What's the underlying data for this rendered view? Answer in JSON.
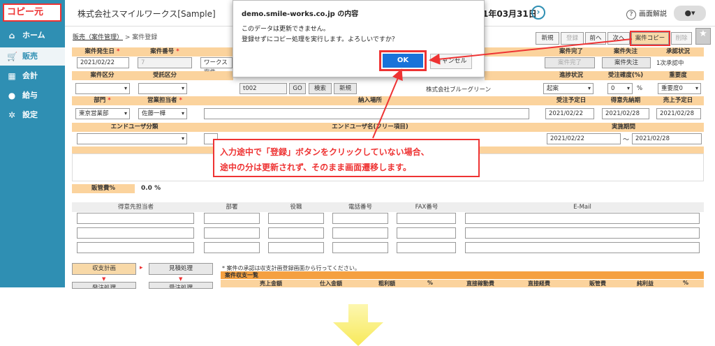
{
  "sidebar": {
    "copy_label": "コピー元",
    "items": [
      {
        "label": "ホーム",
        "icon": "home-icon"
      },
      {
        "label": "販売",
        "icon": "cart-icon"
      },
      {
        "label": "会計",
        "icon": "calculator-icon"
      },
      {
        "label": "給与",
        "icon": "moneybag-icon"
      },
      {
        "label": "設定",
        "icon": "gear-icon"
      }
    ]
  },
  "header": {
    "company": "株式会社スマイルワークス[Sample]",
    "date": "1年03月31日",
    "help_label": "画面解説"
  },
  "breadcrumb": {
    "parent": "販売（案件管理）",
    "current": "> 案件登録"
  },
  "toolbar": {
    "new": "新規",
    "register": "登録",
    "prev": "前へ",
    "next": "次へ",
    "copy": "案件コピー",
    "delete": "削除"
  },
  "form": {
    "hdr_date": "案件発生日",
    "hdr_no": "案件番号",
    "date_value": "2021/02/22",
    "no_value": "7",
    "name_value": "ワークス案件",
    "hdr_complete": "案件完了",
    "hdr_lost": "案件失注",
    "hdr_approval": "承認状況",
    "btn_complete": "案件完了",
    "btn_lost": "案件失注",
    "approval_value": "1次承認中",
    "hdr_category": "案件区分",
    "hdr_received": "受託区分",
    "customer_code": "t002",
    "go": "GO",
    "search": "検索",
    "new": "新規",
    "customer_name": "株式会社ブルーグリーン",
    "hdr_progress": "進捗状況",
    "hdr_prob": "受注確度(%)",
    "hdr_importance": "重要度",
    "progress_value": "起案",
    "prob_value": "0",
    "prob_unit": "%",
    "importance_value": "重要度0",
    "hdr_dept": "部門",
    "hdr_staff": "営業担当者",
    "hdr_place": "納入場所",
    "dept_value": "東京営業部",
    "staff_value": "佐藤一樺",
    "hdr_order_date": "受注予定日",
    "hdr_delivery": "得意先納期",
    "hdr_sales_date": "売上予定日",
    "order_date": "2021/02/22",
    "delivery_date": "2021/02/28",
    "sales_date": "2021/02/28",
    "hdr_enduser_cat": "エンドユーザ分類",
    "hdr_enduser_name": "エンドユーザ名(フリー項目)",
    "hdr_period": "実施期間",
    "period_from": "2021/02/22",
    "period_sep": "〜",
    "period_to": "2021/02/28",
    "hdr_sga": "販管費%",
    "sga_value": "0.0 %"
  },
  "contacts": {
    "headers": [
      "得意先担当者",
      "部署",
      "役職",
      "電話番号",
      "FAX番号",
      "E-Mail"
    ]
  },
  "bottom": {
    "plan_btn": "収支計画",
    "estimate_btn": "見積処理",
    "order_btn": "発注処理",
    "receive_btn": "受注処理",
    "note": "* 案件の承認は収支計画登録画面から行ってください。",
    "table_title": "案件収支一覧",
    "cols": [
      "売上金額",
      "仕入金額",
      "粗利額",
      "%",
      "直接稼動費",
      "直接経費",
      "販管費",
      "純利益",
      "%"
    ]
  },
  "dialog": {
    "title": "demo.smile-works.co.jp の内容",
    "line1": "このデータは更新できません。",
    "line2": "登録せずにコピー処理を実行します。よろしいですか？",
    "ok": "OK",
    "cancel": "キャンセル"
  },
  "callout": {
    "line1": "入力途中で「登録」ボタンをクリックしていない場合、",
    "line2": "途中の分は更新されず、そのまま画面遷移します。"
  },
  "colors": {
    "sidebar": "#2f8fb3",
    "header_fill": "#fbd39d",
    "accent_red": "#e33",
    "ok_blue": "#1a73d9"
  }
}
